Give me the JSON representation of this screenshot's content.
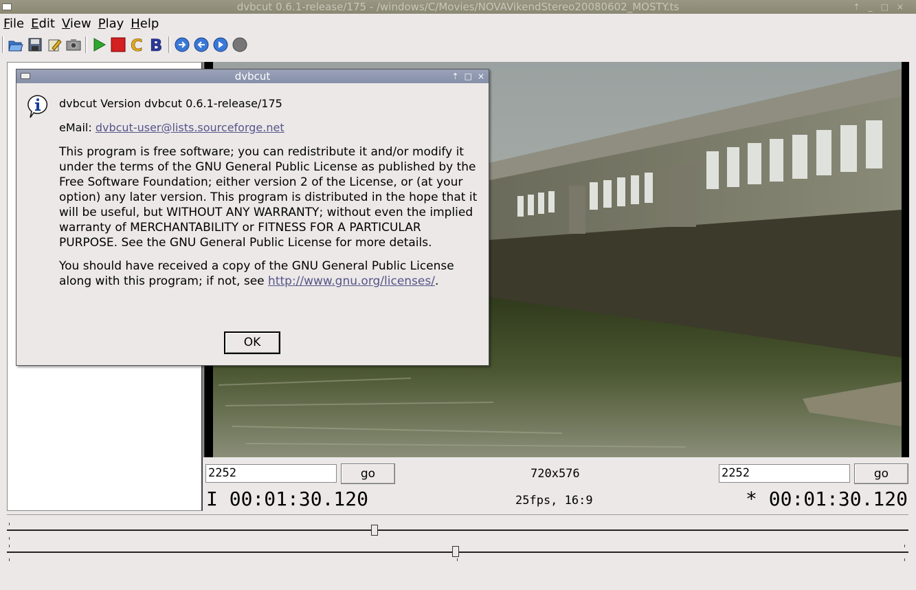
{
  "window": {
    "title": "dvbcut 0.6.1-release/175 - /windows/C/Movies/NOVAVikendStereo20080602_MOSTY.ts"
  },
  "menu": [
    {
      "label": "File",
      "key": "F",
      "rest": "ile"
    },
    {
      "label": "Edit",
      "key": "E",
      "rest": "dit"
    },
    {
      "label": "View",
      "key": "V",
      "rest": "iew"
    },
    {
      "label": "Play",
      "key": "P",
      "rest": "lay"
    },
    {
      "label": "Help",
      "key": "H",
      "rest": "elp"
    }
  ],
  "toolbar": {
    "icons": [
      "open-icon",
      "save-icon",
      "edit-icon",
      "snapshot-icon",
      "play-icon",
      "stop-icon",
      "c-icon",
      "b-icon",
      "jump-forward-icon",
      "jump-back-icon",
      "next-icon",
      "record-icon"
    ]
  },
  "controls": {
    "left_frame": "2252",
    "right_frame": "2252",
    "go_label": "go",
    "resolution": "720x576",
    "fps_aspect": "25fps, 16:9",
    "left_time": "I 00:01:30.120",
    "right_time": "* 00:01:30.120"
  },
  "sliders": {
    "top_position": 0.408,
    "bottom_position": 0.498
  },
  "dialog": {
    "title": "dvbcut",
    "version": "dvbcut Version dvbcut 0.6.1-release/175",
    "email_label": "eMail: ",
    "email": "dvbcut-user@lists.sourceforge.net",
    "license_p1": "This program is free software; you can redistribute it and/or modify it under the terms of the GNU General Public License as published by the Free Software Foundation; either version 2 of the License, or (at your option) any later version. This program is distributed in the hope that it will be useful, but WITHOUT ANY WARRANTY; without even the implied warranty of MERCHANTABILITY or FITNESS FOR A PARTICULAR PURPOSE. See the GNU General Public License for more details.",
    "license_p2_pre": "You should have received a copy of the GNU General Public License along with this program; if not, see ",
    "license_url": "http://www.gnu.org/licenses/",
    "license_p2_post": ".",
    "ok_label": "OK"
  }
}
